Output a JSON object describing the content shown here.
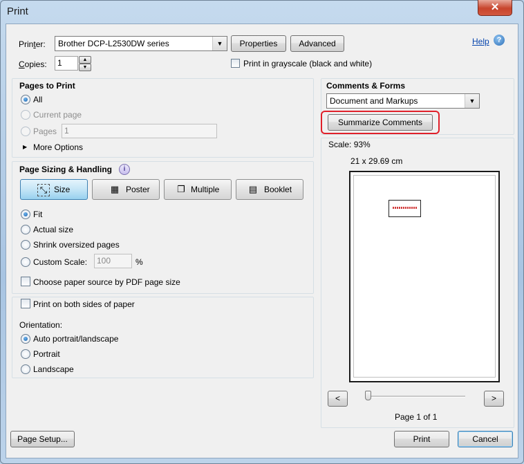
{
  "window": {
    "title": "Print",
    "close_glyph": "✕"
  },
  "printer": {
    "label": "Printer:",
    "selected": "Brother DCP-L2530DW series",
    "properties_label": "Properties",
    "advanced_label": "Advanced",
    "help_label": "Help",
    "copies_label": "Copies:",
    "copies_value": "1",
    "grayscale_label": "Print in grayscale (black and white)"
  },
  "pages_to_print": {
    "title": "Pages to Print",
    "all_label": "All",
    "current_label": "Current page",
    "pages_label": "Pages",
    "pages_value": "1",
    "more_options_label": "More Options"
  },
  "sizing": {
    "title": "Page Sizing & Handling",
    "info_glyph": "i",
    "buttons": [
      "Size",
      "Poster",
      "Multiple",
      "Booklet"
    ],
    "fit_label": "Fit",
    "actual_label": "Actual size",
    "shrink_label": "Shrink oversized pages",
    "custom_label": "Custom Scale:",
    "custom_value": "100",
    "percent": "%",
    "paper_source_label": "Choose paper source by PDF page size"
  },
  "duplex": {
    "both_sides_label": "Print on both sides of paper",
    "orientation_label": "Orientation:",
    "auto_label": "Auto portrait/landscape",
    "portrait_label": "Portrait",
    "landscape_label": "Landscape"
  },
  "comments": {
    "title": "Comments & Forms",
    "selected": "Document and Markups",
    "summarize_label": "Summarize Comments",
    "highlight_color": "#e0202a"
  },
  "preview": {
    "scale_label": "Scale:",
    "scale_value": "93%",
    "dimensions": "21 x 29.69 cm",
    "prev_glyph": "<",
    "next_glyph": ">",
    "page_info": "Page 1 of 1",
    "slider_position": 0
  },
  "footer": {
    "page_setup_label": "Page Setup...",
    "print_label": "Print",
    "cancel_label": "Cancel"
  }
}
